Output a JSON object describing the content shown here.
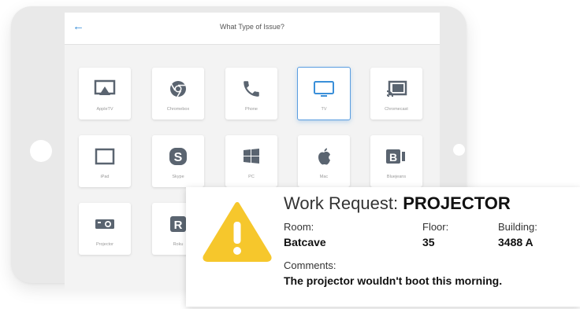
{
  "header": {
    "back_icon": "arrow-left-icon",
    "title": "What Type of Issue?"
  },
  "tiles": [
    {
      "label": "AppleTV",
      "icon": "appletv-icon"
    },
    {
      "label": "Chromebox",
      "icon": "chrome-icon"
    },
    {
      "label": "Phone",
      "icon": "phone-icon"
    },
    {
      "label": "TV",
      "icon": "tv-icon",
      "selected": true
    },
    {
      "label": "Chromecast",
      "icon": "cast-icon"
    },
    {
      "label": "iPad",
      "icon": "tablet-icon"
    },
    {
      "label": "Skype",
      "icon": "skype-icon"
    },
    {
      "label": "PC",
      "icon": "windows-icon"
    },
    {
      "label": "Mac",
      "icon": "apple-icon"
    },
    {
      "label": "Bluejeans",
      "icon": "bluejeans-icon"
    },
    {
      "label": "Projector",
      "icon": "projector-icon"
    },
    {
      "label": "Roku",
      "icon": "roku-icon"
    }
  ],
  "work_request": {
    "title_prefix": "Work Request:",
    "title_item": "PROJECTOR",
    "room_label": "Room:",
    "room_value": "Batcave",
    "floor_label": "Floor:",
    "floor_value": "35",
    "building_label": "Building:",
    "building_value": "3488 A",
    "comments_label": "Comments:",
    "comments_value": "The projector wouldn't boot this morning.",
    "warning_icon": "warning-icon"
  },
  "colors": {
    "accent": "#3a8fd9",
    "icon": "#5a6470",
    "warning": "#f6c72c"
  }
}
